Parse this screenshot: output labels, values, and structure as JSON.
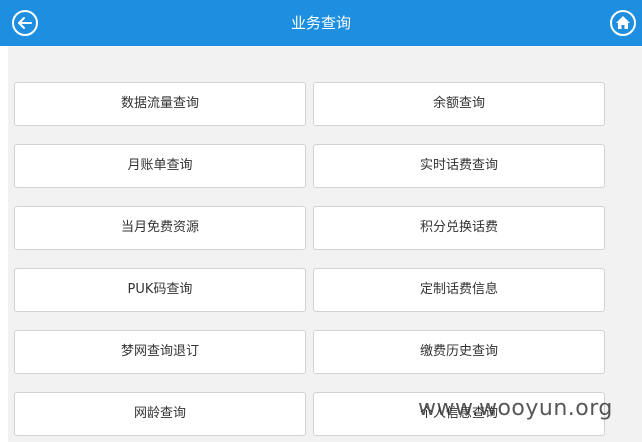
{
  "header": {
    "title": "业务查询",
    "back_icon": "back-arrow-icon",
    "home_icon": "home-icon",
    "bg_color": "#1e8fe0"
  },
  "menu": {
    "items": [
      {
        "label": "数据流量查询"
      },
      {
        "label": "余额查询"
      },
      {
        "label": "月账单查询"
      },
      {
        "label": "实时话费查询"
      },
      {
        "label": "当月免费资源"
      },
      {
        "label": "积分兑换话费"
      },
      {
        "label": "PUK码查询"
      },
      {
        "label": "定制话费信息"
      },
      {
        "label": "梦网查询退订"
      },
      {
        "label": "缴费历史查询"
      },
      {
        "label": "网龄查询"
      },
      {
        "label": "个人信息查询"
      }
    ]
  },
  "watermark": {
    "text": "www.wooyun.org"
  }
}
